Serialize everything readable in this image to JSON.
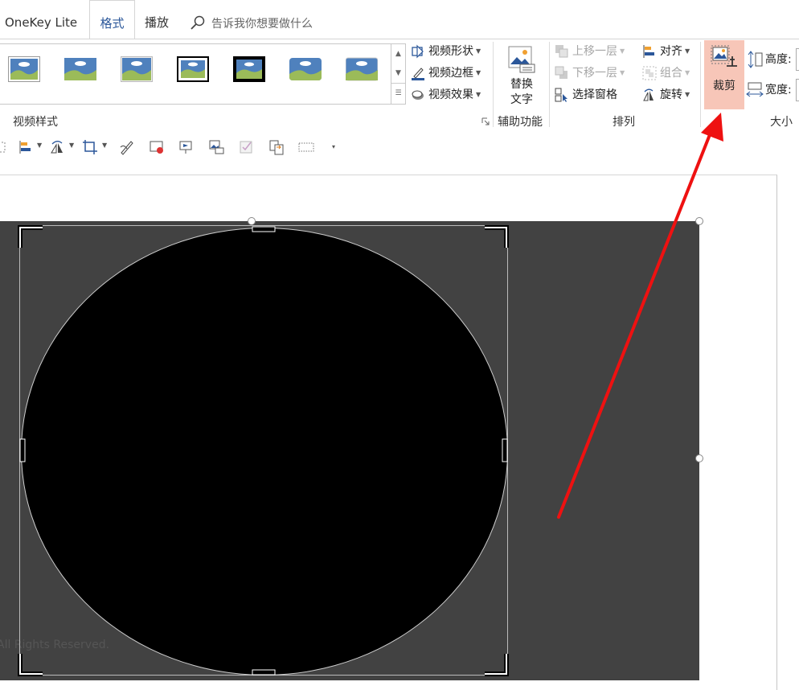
{
  "tabs": [
    {
      "label": "OneKey Lite"
    },
    {
      "label": "格式",
      "active": true
    },
    {
      "label": "播放"
    }
  ],
  "tell_me": {
    "placeholder": "告诉我你想要做什么"
  },
  "ribbon": {
    "video_styles": {
      "group_label": "视频样式",
      "buttons": {
        "shape": "视频形状",
        "border": "视频边框",
        "effects": "视频效果"
      }
    },
    "accessibility": {
      "alt_text_line1": "替换",
      "alt_text_line2": "文字",
      "group_label": "辅助功能"
    },
    "arrange": {
      "bring_forward": "上移一层",
      "send_backward": "下移一层",
      "selection_pane": "选择窗格",
      "align": "对齐",
      "group": "组合",
      "rotate": "旋转",
      "group_label": "排列"
    },
    "size": {
      "crop": "裁剪",
      "height": "高度:",
      "width": "宽度:",
      "group_label": "大小"
    }
  },
  "slide": {
    "watermark": "All Rights Reserved."
  },
  "colors": {
    "active_tab": "#2b579a",
    "crop_highlight": "#f7c6b8",
    "arrow": "#ee1111",
    "video_bg": "#424242"
  }
}
